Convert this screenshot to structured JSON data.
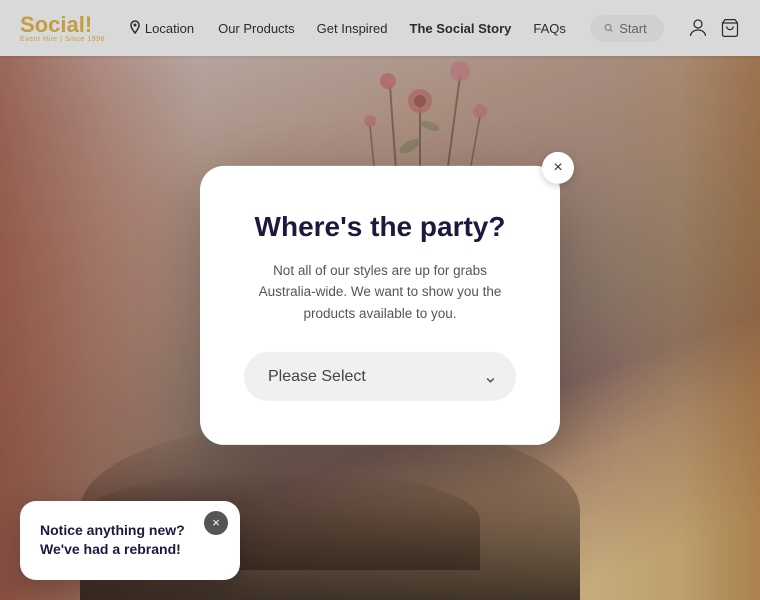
{
  "logo": {
    "brand": "Social",
    "tagline": "Event Hire | Since 1996"
  },
  "navbar": {
    "location_label": "Location",
    "links": [
      {
        "id": "our-products",
        "label": "Our Products",
        "active": false
      },
      {
        "id": "get-inspired",
        "label": "Get Inspired",
        "active": false
      },
      {
        "id": "the-social-story",
        "label": "The Social Story",
        "active": true
      },
      {
        "id": "faqs",
        "label": "FAQs",
        "active": false
      }
    ],
    "search_placeholder": "Start searching..."
  },
  "modal": {
    "title": "Where's the party?",
    "description": "Not all of our styles are up for grabs Australia-wide. We want to show you the products available to you.",
    "select_placeholder": "Please Select",
    "close_label": "×"
  },
  "bottom_popup": {
    "text": "Notice anything new?\nWe've had a rebrand!",
    "close_label": "×"
  }
}
